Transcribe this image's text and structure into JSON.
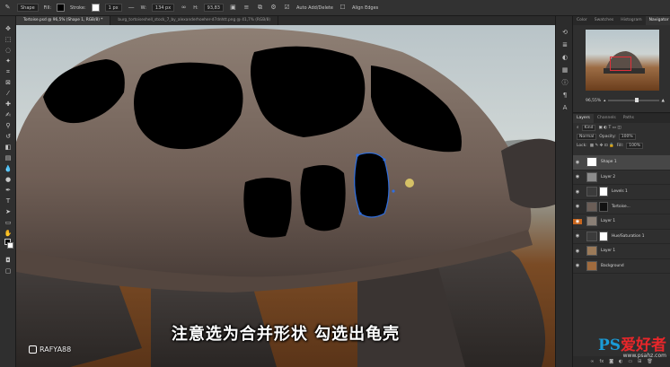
{
  "options_bar": {
    "tool_mode": "Shape",
    "fill_label": "Fill:",
    "stroke_label": "Stroke:",
    "stroke_width": "1 px",
    "w_label": "W:",
    "w_value": "134 px",
    "h_label": "H:",
    "h_value": "93,83",
    "auto_add_label": "Auto Add/Delete",
    "align_edges_label": "Align Edges"
  },
  "document_tabs": [
    {
      "label": "Tortoise.psd @ 96,5% (Shape 1, RGB/8) *",
      "active": true
    },
    {
      "label": "burg_tortoiseshell_stock_7_by_alexanderhoeher-d7dnhtt.png @ 41,7% (RGB/8)",
      "active": false
    }
  ],
  "canvas": {
    "subtitle": "注意选为合并形状 勾选出龟壳",
    "channel_watermark": "RAFYA88"
  },
  "navigator": {
    "tabs": [
      "Color",
      "Swatches",
      "Histogram",
      "Navigator"
    ],
    "active_tab": "Navigator",
    "zoom": "96,55%"
  },
  "layers_panel": {
    "tabs": [
      "Layers",
      "Channels",
      "Paths"
    ],
    "filter_kind": "Kind",
    "blend_mode": "Normal",
    "opacity_label": "Opacity:",
    "opacity_value": "100%",
    "lock_label": "Lock:",
    "fill_label": "Fill:",
    "fill_value": "100%",
    "layers": [
      {
        "name": "Shape 1",
        "selected": true
      },
      {
        "name": "Layer 2",
        "selected": false
      },
      {
        "name": "Levels 1",
        "selected": false
      },
      {
        "name": "Tortoise...",
        "selected": false
      },
      {
        "name": "Layer 1",
        "selected": false
      },
      {
        "name": "Hue/Saturation 1",
        "selected": false
      },
      {
        "name": "Layer 1",
        "selected": false
      },
      {
        "name": "Background",
        "selected": false
      }
    ]
  },
  "site_watermark": {
    "ps": "PS",
    "text": "爱好者",
    "url": "www.psahz.com"
  },
  "colors": {
    "selection_path": "#2f6fe0",
    "watermark_blue": "#1a9bd7",
    "watermark_red": "#e8262a"
  }
}
